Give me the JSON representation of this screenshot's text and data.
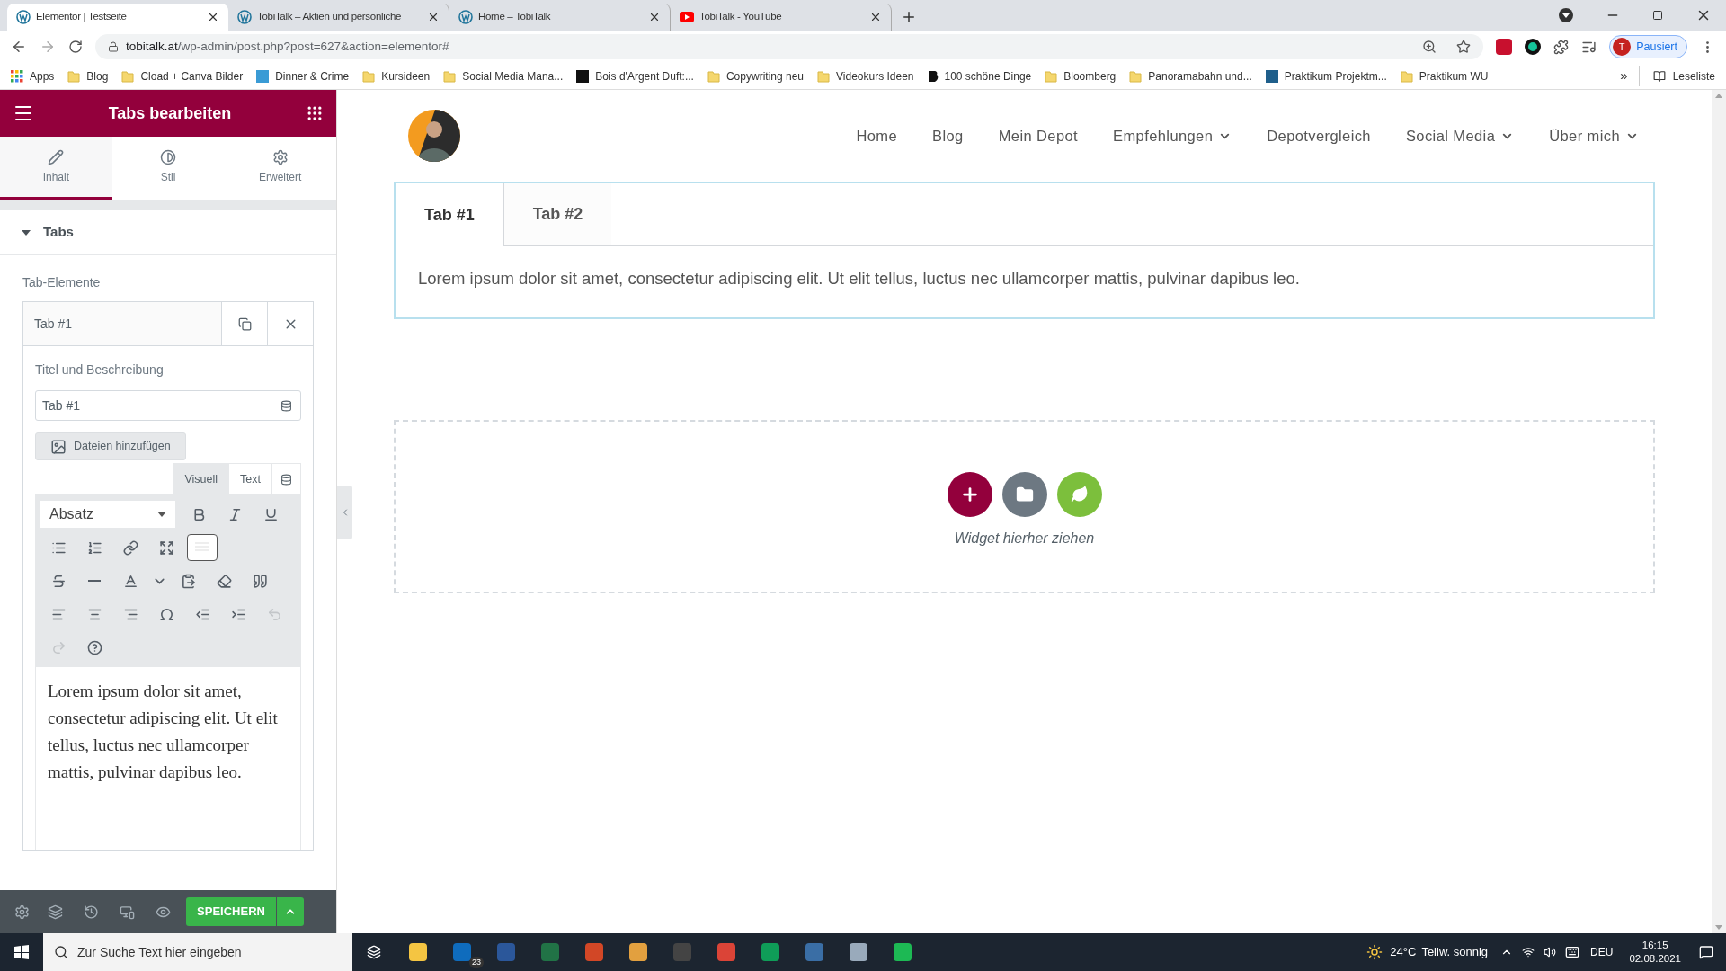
{
  "browser": {
    "tabs": [
      {
        "title": "Elementor | Testseite",
        "selected": true,
        "kind": "wordpress"
      },
      {
        "title": "TobiTalk – Aktien und persönliche",
        "selected": false,
        "kind": "wordpress"
      },
      {
        "title": "Home – TobiTalk",
        "selected": false,
        "kind": "wordpress"
      },
      {
        "title": "TobiTalk - YouTube",
        "selected": false,
        "kind": "youtube"
      }
    ],
    "url_host": "tobitalk.at",
    "url_path": "/wp-admin/post.php?post=627&action=elementor#",
    "profile": {
      "initial": "T",
      "status": "Pausiert"
    },
    "bookmarks": [
      {
        "label": "Apps",
        "kind": "apps"
      },
      {
        "label": "Blog",
        "kind": "folder"
      },
      {
        "label": "Cload + Canva Bilder",
        "kind": "folder"
      },
      {
        "label": "Dinner & Crime",
        "kind": "site",
        "color": "#3a9bd5"
      },
      {
        "label": "Kursideen",
        "kind": "folder"
      },
      {
        "label": "Social Media Mana...",
        "kind": "folder"
      },
      {
        "label": "Bois d'Argent Duft:...",
        "kind": "site",
        "color": "#111111"
      },
      {
        "label": "Copywriting neu",
        "kind": "folder"
      },
      {
        "label": "Videokurs Ideen",
        "kind": "folder"
      },
      {
        "label": "100 schöne Dinge",
        "kind": "bold"
      },
      {
        "label": "Bloomberg",
        "kind": "folder"
      },
      {
        "label": "Panoramabahn und...",
        "kind": "folder"
      },
      {
        "label": "Praktikum Projektm...",
        "kind": "site",
        "color": "#1f5f8b"
      },
      {
        "label": "Praktikum WU",
        "kind": "folder"
      }
    ],
    "overflow": "»",
    "reading_list": "Leseliste"
  },
  "sidebar": {
    "title": "Tabs bearbeiten",
    "panel_tabs": [
      {
        "label": "Inhalt",
        "selected": true,
        "kind": "pencil"
      },
      {
        "label": "Stil",
        "selected": false,
        "kind": "contrast"
      },
      {
        "label": "Erweitert",
        "selected": false,
        "kind": "gear"
      }
    ],
    "section": {
      "title": "Tabs",
      "expanded": true
    },
    "repeater_label": "Tab-Elemente",
    "item": {
      "title": "Tab #1",
      "expanded": true
    },
    "field_label": "Titel und Beschreibung",
    "field_value": "Tab #1",
    "add_media": "Dateien hinzufügen",
    "editor_tabs": [
      {
        "label": "Visuell",
        "selected": true
      },
      {
        "label": "Text",
        "selected": false
      }
    ],
    "format": "Absatz",
    "toolbar_rows": [
      [
        {
          "kind": "bold",
          "disabled": false,
          "pressed": false
        },
        {
          "kind": "italic",
          "disabled": false,
          "pressed": false
        },
        {
          "kind": "underline",
          "disabled": false,
          "pressed": false
        }
      ],
      [
        {
          "kind": "bullets",
          "disabled": false,
          "pressed": false
        },
        {
          "kind": "numbers",
          "disabled": false,
          "pressed": false
        },
        {
          "kind": "link",
          "disabled": false,
          "pressed": false
        },
        {
          "kind": "fullscreen",
          "disabled": false,
          "pressed": false
        },
        {
          "kind": "toolbar",
          "disabled": false,
          "pressed": true
        }
      ],
      [
        {
          "kind": "strike",
          "disabled": false,
          "pressed": false
        },
        {
          "kind": "rule",
          "disabled": false,
          "pressed": false
        },
        {
          "kind": "textcolor",
          "disabled": false,
          "pressed": false
        },
        {
          "kind": "colormenu",
          "disabled": false,
          "pressed": false
        },
        {
          "kind": "paste",
          "disabled": false,
          "pressed": false
        },
        {
          "kind": "eraser",
          "disabled": false,
          "pressed": false
        },
        {
          "kind": "quote",
          "disabled": false,
          "pressed": false
        }
      ],
      [
        {
          "kind": "alignleft",
          "disabled": false,
          "pressed": false
        },
        {
          "kind": "aligncenter",
          "disabled": false,
          "pressed": false
        },
        {
          "kind": "alignright",
          "disabled": false,
          "pressed": false
        },
        {
          "kind": "omega",
          "disabled": false,
          "pressed": false
        },
        {
          "kind": "outdent",
          "disabled": false,
          "pressed": false
        },
        {
          "kind": "indent",
          "disabled": false,
          "pressed": false
        },
        {
          "kind": "undo",
          "disabled": true,
          "pressed": false
        }
      ],
      [
        {
          "kind": "redo",
          "disabled": true,
          "pressed": false
        },
        {
          "kind": "help",
          "disabled": false,
          "pressed": false
        }
      ]
    ],
    "body": "Lorem ipsum dolor sit amet, consectetur adipiscing elit. Ut elit tellus, luctus nec ullamcorper mattis, pulvinar dapibus leo.",
    "save": "SPEICHERN"
  },
  "page": {
    "nav": [
      {
        "label": "Home",
        "dropdown": false
      },
      {
        "label": "Blog",
        "dropdown": false
      },
      {
        "label": "Mein Depot",
        "dropdown": false
      },
      {
        "label": "Empfehlungen",
        "dropdown": true
      },
      {
        "label": "Depotvergleich",
        "dropdown": false
      },
      {
        "label": "Social Media",
        "dropdown": true
      },
      {
        "label": "Über mich",
        "dropdown": true
      }
    ],
    "tabs": [
      {
        "label": "Tab #1",
        "selected": true
      },
      {
        "label": "Tab #2",
        "selected": false
      }
    ],
    "tab_content": "Lorem ipsum dolor sit amet, consectetur adipiscing elit. Ut elit tellus, luctus nec ullamcorper mattis, pulvinar dapibus leo.",
    "drop_hint": "Widget hierher ziehen"
  },
  "taskbar": {
    "search_placeholder": "Zur Suche Text hier eingeben",
    "mail_badge": "23",
    "temperature": "24°C",
    "weather": "Teilw. sonnig",
    "language": "DEU",
    "time": "16:15",
    "date": "02.08.2021"
  }
}
